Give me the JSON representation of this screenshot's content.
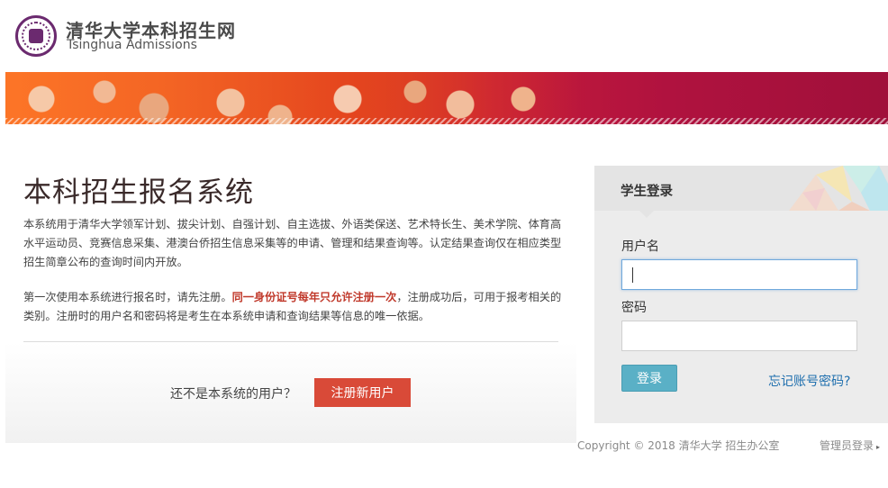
{
  "header": {
    "title_cn": "清华大学本科招生网",
    "title_en": "Tsinghua Admissions",
    "brand_color": "#6b2a6f"
  },
  "banner": {
    "accent_colors": [
      "#e65a1e",
      "#c41b3a",
      "#a0103a"
    ]
  },
  "main": {
    "title": "本科招生报名系统",
    "intro": "本系统用于清华大学领军计划、拔尖计划、自强计划、自主选拔、外语类保送、艺术特长生、美术学院、体育高水平运动员、竞赛信息采集、港澳台侨招生信息采集等的申请、管理和结果查询等。认定结果查询仅在相应类型招生简章公布的查询时间内开放。",
    "notice_before": "第一次使用本系统进行报名时，请先注册。",
    "notice_warning": "同一身份证号每年只允许注册一次",
    "notice_after": "，注册成功后，可用于报考相关的类别。注册时的用户名和密码将是考生在本系统申请和查询结果等信息的唯一依据。",
    "register_prompt": "还不是本系统的用户？",
    "register_button": "注册新用户",
    "warning_color": "#c0392b",
    "register_button_color": "#d94a38"
  },
  "login": {
    "title": "学生登录",
    "username_label": "用户名",
    "username_value": "",
    "password_label": "密码",
    "password_value": "",
    "login_button": "登录",
    "forgot_link": "忘记账号密码?",
    "login_button_color": "#5ab0c6",
    "link_color": "#1f6fae"
  },
  "footer": {
    "copyright": "Copyright © 2018 清华大学 招生办公室",
    "admin_login": "管理员登录"
  }
}
